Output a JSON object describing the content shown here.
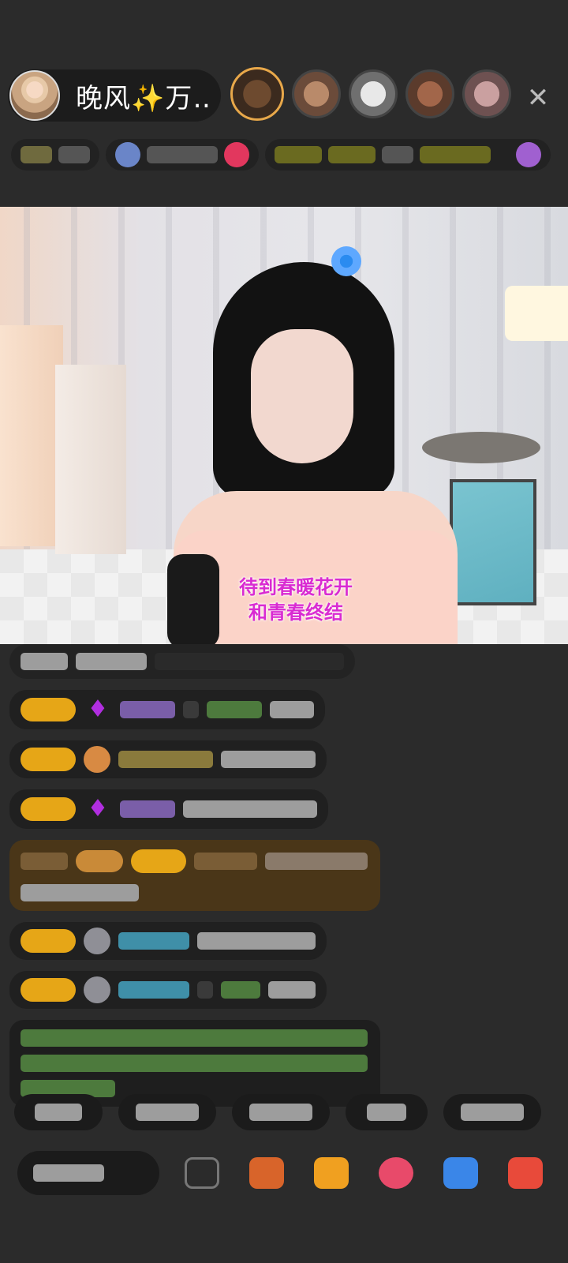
{
  "header": {
    "host_name": "晚风✨万…",
    "close_glyph": "✕",
    "viewers_shown": 5
  },
  "video": {
    "lyrics": [
      "待到春暖花开",
      "和青春终结"
    ]
  },
  "colors": {
    "background": "#2b2b2b",
    "badge": "#e6a617",
    "lyrics": "#d92bd2",
    "highlight_message_bg": "#4a3618",
    "gem": "#b12ee0"
  },
  "icons": {
    "host_avatar": "avatar",
    "close": "close-icon",
    "gem": "diamond-icon"
  }
}
